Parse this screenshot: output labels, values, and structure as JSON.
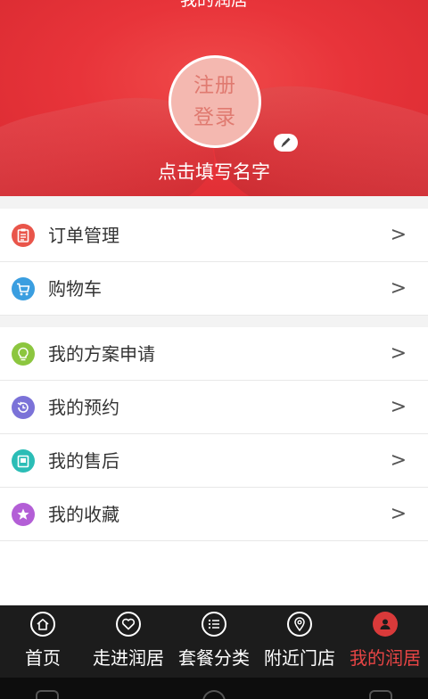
{
  "header": {
    "title": "我的润居",
    "avatar_line1": "注册",
    "avatar_line2": "登录",
    "user_name": "点击填写名字"
  },
  "group1": [
    {
      "label": "订单管理",
      "icon": "clipboard-icon",
      "color": "#e9554a"
    },
    {
      "label": "购物车",
      "icon": "cart-icon",
      "color": "#3a9ee0"
    }
  ],
  "group2": [
    {
      "label": "我的方案申请",
      "icon": "lightbulb-icon",
      "color": "#8cc63f"
    },
    {
      "label": "我的预约",
      "icon": "clock-history-icon",
      "color": "#7b72d8"
    },
    {
      "label": "我的售后",
      "icon": "monitor-icon",
      "color": "#2bbdb6"
    },
    {
      "label": "我的收藏",
      "icon": "star-icon",
      "color": "#b35ed6"
    }
  ],
  "chevron": ">",
  "nav": [
    {
      "label": "首页",
      "icon": "home-icon"
    },
    {
      "label": "走进润居",
      "icon": "heart-icon"
    },
    {
      "label": "套餐分类",
      "icon": "list-icon"
    },
    {
      "label": "附近门店",
      "icon": "location-pin-icon"
    },
    {
      "label": "我的润居",
      "icon": "user-icon",
      "active": true
    }
  ],
  "colors": {
    "brand_red": "#e8343a",
    "active_tab": "#e84545",
    "nav_bg": "#1c1c1c"
  }
}
